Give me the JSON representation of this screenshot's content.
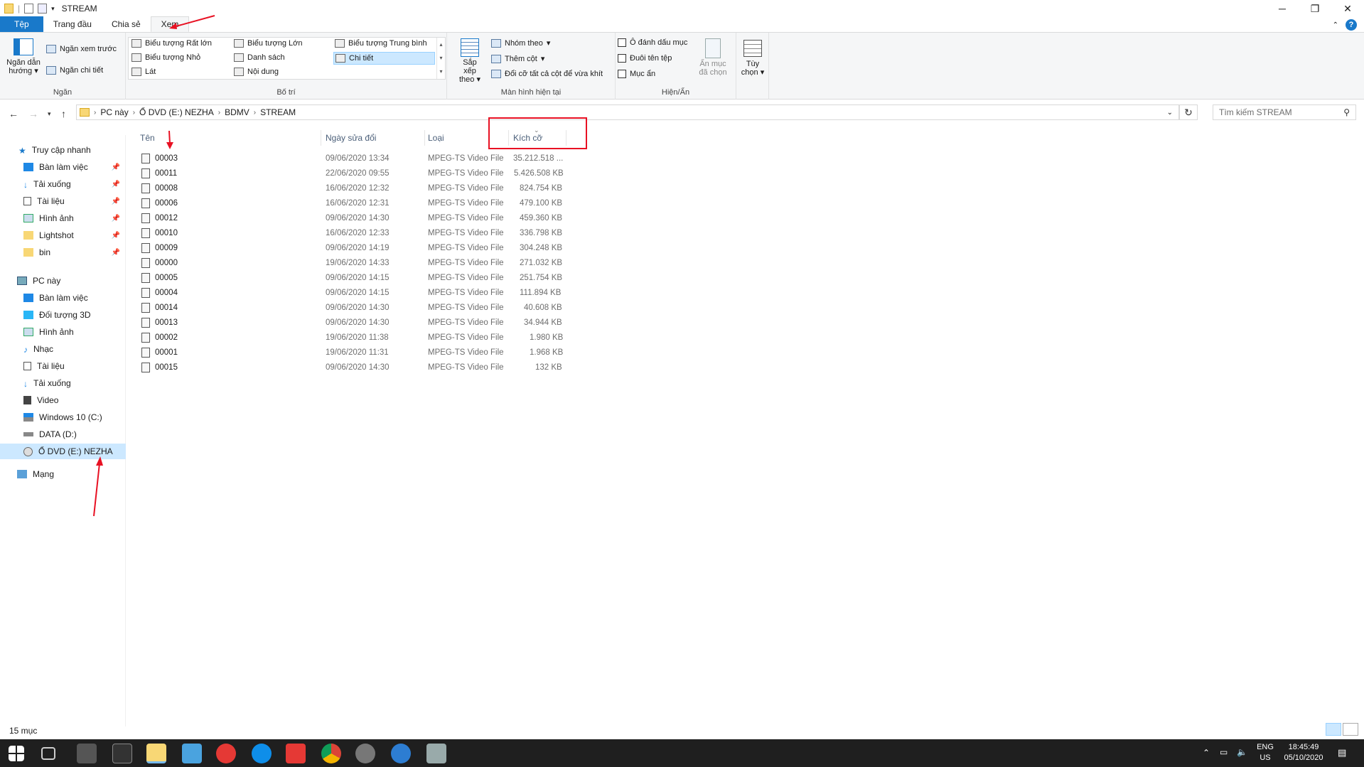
{
  "window": {
    "title": "STREAM"
  },
  "tabs": [
    "Tệp",
    "Trang đầu",
    "Chia sẻ",
    "Xem"
  ],
  "ribbon": {
    "ngan": {
      "label": "Ngăn",
      "nav_pane": "Ngăn dẫn hướng",
      "preview": "Ngăn xem trước",
      "details_pane": "Ngăn chi tiết"
    },
    "layout": {
      "label": "Bố trí",
      "items": [
        "Biểu tượng Rất lớn",
        "Biểu tượng Lớn",
        "Biểu tượng Trung bình",
        "Biểu tượng Nhỏ",
        "Danh sách",
        "Chi tiết",
        "Lát",
        "Nội dung"
      ]
    },
    "current_view": {
      "label": "Màn hình hiện tại",
      "sort": "Sắp xếp theo",
      "group": "Nhóm theo",
      "add_col": "Thêm cột",
      "fit_cols": "Đổi cỡ tất cả cột để vừa khít"
    },
    "show_hide": {
      "label": "Hiện/Ẩn",
      "checkboxes": "Ô đánh dấu mục",
      "extensions": "Đuôi tên tệp",
      "hidden": "Mục ẩn",
      "hide_selected": "Ẩn mục đã chọn"
    },
    "options": "Tùy chọn"
  },
  "address": {
    "crumbs": [
      "PC này",
      "Ổ DVD (E:) NEZHA",
      "BDMV",
      "STREAM"
    ],
    "search_placeholder": "Tìm kiếm STREAM"
  },
  "nav": {
    "quick_access": "Truy cập nhanh",
    "quick": [
      "Bàn làm việc",
      "Tải xuống",
      "Tài liệu",
      "Hình ảnh",
      "Lightshot",
      "bin"
    ],
    "this_pc": "PC này",
    "pc": [
      "Bàn làm việc",
      "Đối tượng 3D",
      "Hình ảnh",
      "Nhạc",
      "Tài liệu",
      "Tải xuống",
      "Video",
      "Windows 10 (C:)",
      "DATA (D:)",
      "Ổ DVD (E:) NEZHA"
    ],
    "network": "Mạng"
  },
  "columns": {
    "name": "Tên",
    "date": "Ngày sửa đổi",
    "type": "Loại",
    "size": "Kích cỡ"
  },
  "files": [
    {
      "name": "00003",
      "date": "09/06/2020 13:34",
      "type": "MPEG-TS Video File",
      "size": "35.212.518 ..."
    },
    {
      "name": "00011",
      "date": "22/06/2020 09:55",
      "type": "MPEG-TS Video File",
      "size": "5.426.508 KB"
    },
    {
      "name": "00008",
      "date": "16/06/2020 12:32",
      "type": "MPEG-TS Video File",
      "size": "824.754 KB"
    },
    {
      "name": "00006",
      "date": "16/06/2020 12:31",
      "type": "MPEG-TS Video File",
      "size": "479.100 KB"
    },
    {
      "name": "00012",
      "date": "09/06/2020 14:30",
      "type": "MPEG-TS Video File",
      "size": "459.360 KB"
    },
    {
      "name": "00010",
      "date": "16/06/2020 12:33",
      "type": "MPEG-TS Video File",
      "size": "336.798 KB"
    },
    {
      "name": "00009",
      "date": "09/06/2020 14:19",
      "type": "MPEG-TS Video File",
      "size": "304.248 KB"
    },
    {
      "name": "00000",
      "date": "19/06/2020 14:33",
      "type": "MPEG-TS Video File",
      "size": "271.032 KB"
    },
    {
      "name": "00005",
      "date": "09/06/2020 14:15",
      "type": "MPEG-TS Video File",
      "size": "251.754 KB"
    },
    {
      "name": "00004",
      "date": "09/06/2020 14:15",
      "type": "MPEG-TS Video File",
      "size": "111.894 KB"
    },
    {
      "name": "00014",
      "date": "09/06/2020 14:30",
      "type": "MPEG-TS Video File",
      "size": "40.608 KB"
    },
    {
      "name": "00013",
      "date": "09/06/2020 14:30",
      "type": "MPEG-TS Video File",
      "size": "34.944 KB"
    },
    {
      "name": "00002",
      "date": "19/06/2020 11:38",
      "type": "MPEG-TS Video File",
      "size": "1.980 KB"
    },
    {
      "name": "00001",
      "date": "19/06/2020 11:31",
      "type": "MPEG-TS Video File",
      "size": "1.968 KB"
    },
    {
      "name": "00015",
      "date": "09/06/2020 14:30",
      "type": "MPEG-TS Video File",
      "size": "132 KB"
    }
  ],
  "status": "15 mục",
  "taskbar": {
    "lang1": "ENG",
    "lang2": "US",
    "time": "18:45:49",
    "date": "05/10/2020"
  },
  "colors": {
    "accent": "#1979ca",
    "selection": "#cce8ff",
    "annotation": "#e81123"
  }
}
